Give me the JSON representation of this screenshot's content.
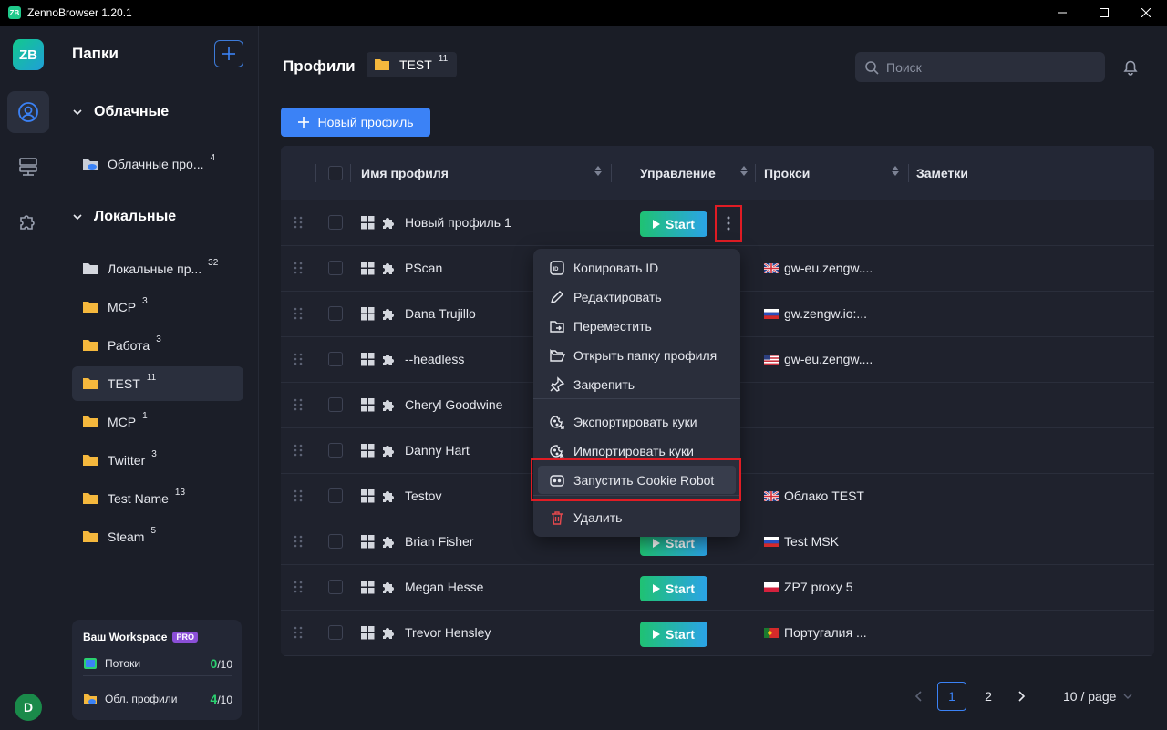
{
  "window": {
    "title": "ZennoBrowser 1.20.1",
    "logo": "ZB"
  },
  "rail": {
    "logo": "ZB",
    "avatar": "D",
    "items": [
      "profile-icon",
      "server-icon",
      "puzzle-icon"
    ]
  },
  "sidebar": {
    "title": "Папки",
    "sections": [
      {
        "label": "Облачные",
        "folders": [
          {
            "name": "Облачные про...",
            "count": "4"
          }
        ]
      },
      {
        "label": "Локальные",
        "folders": [
          {
            "name": "Локальные пр...",
            "count": "32"
          },
          {
            "name": "MCP",
            "count": "3"
          },
          {
            "name": "Работа",
            "count": "3"
          },
          {
            "name": "TEST",
            "count": "11"
          },
          {
            "name": "MCP",
            "count": "1"
          },
          {
            "name": "Twitter",
            "count": "3"
          },
          {
            "name": "Test Name",
            "count": "13"
          },
          {
            "name": "Steam",
            "count": "5"
          }
        ]
      }
    ],
    "workspace": {
      "title": "Ваш Workspace",
      "badge": "PRO",
      "threads": {
        "label": "Потоки",
        "used": "0",
        "total": "/10"
      },
      "cloud": {
        "label": "Обл. профили",
        "used": "4",
        "total": "/10"
      }
    }
  },
  "main": {
    "title": "Профили",
    "crumb": {
      "name": "TEST",
      "count": "11"
    },
    "search_placeholder": "Поиск",
    "new_profile": "Новый профиль",
    "columns": {
      "name": "Имя профиля",
      "control": "Управление",
      "proxy": "Прокси",
      "notes": "Заметки"
    },
    "start_label": "Start",
    "rows": [
      {
        "name": "Новый профиль 1",
        "proxy": "",
        "flag": ""
      },
      {
        "name": "PScan",
        "proxy": "gw-eu.zengw....",
        "flag": "uk"
      },
      {
        "name": "Dana Trujillo",
        "proxy": "gw.zengw.io:...",
        "flag": "ru"
      },
      {
        "name": "--headless",
        "proxy": "gw-eu.zengw....",
        "flag": "us"
      },
      {
        "name": "Cheryl Goodwine",
        "proxy": "",
        "flag": ""
      },
      {
        "name": "Danny Hart",
        "proxy": "",
        "flag": ""
      },
      {
        "name": "Testov",
        "proxy": "Облако TEST",
        "flag": "uk"
      },
      {
        "name": "Brian Fisher",
        "proxy": "Test MSK",
        "flag": "ru"
      },
      {
        "name": "Megan Hesse",
        "proxy": "ZP7 proxy 5",
        "flag": "pl"
      },
      {
        "name": "Trevor Hensley",
        "proxy": "Португалия ...",
        "flag": "pt"
      }
    ],
    "pagination": {
      "pages": [
        "1",
        "2"
      ],
      "current": "1",
      "per_page": "10 / page"
    }
  },
  "context_menu": {
    "items": [
      {
        "label": "Копировать ID",
        "icon": "id-icon"
      },
      {
        "label": "Редактировать",
        "icon": "pencil-icon"
      },
      {
        "label": "Переместить",
        "icon": "folder-move-icon"
      },
      {
        "label": "Открыть папку профиля",
        "icon": "folder-open-icon"
      },
      {
        "label": "Закрепить",
        "icon": "pin-icon"
      },
      {
        "label": "Экспортировать куки",
        "icon": "cookie-export-icon"
      },
      {
        "label": "Импортировать куки",
        "icon": "cookie-import-icon"
      },
      {
        "label": "Запустить Cookie Robot",
        "icon": "robot-icon"
      },
      {
        "label": "Удалить",
        "icon": "trash-icon"
      }
    ]
  },
  "colors": {
    "accent": "#3b82f6",
    "start_from": "#1fc273",
    "start_to": "#2ba3e8",
    "highlight": "#e01c24",
    "folder": "#f5b83d",
    "danger": "#e5484d"
  }
}
